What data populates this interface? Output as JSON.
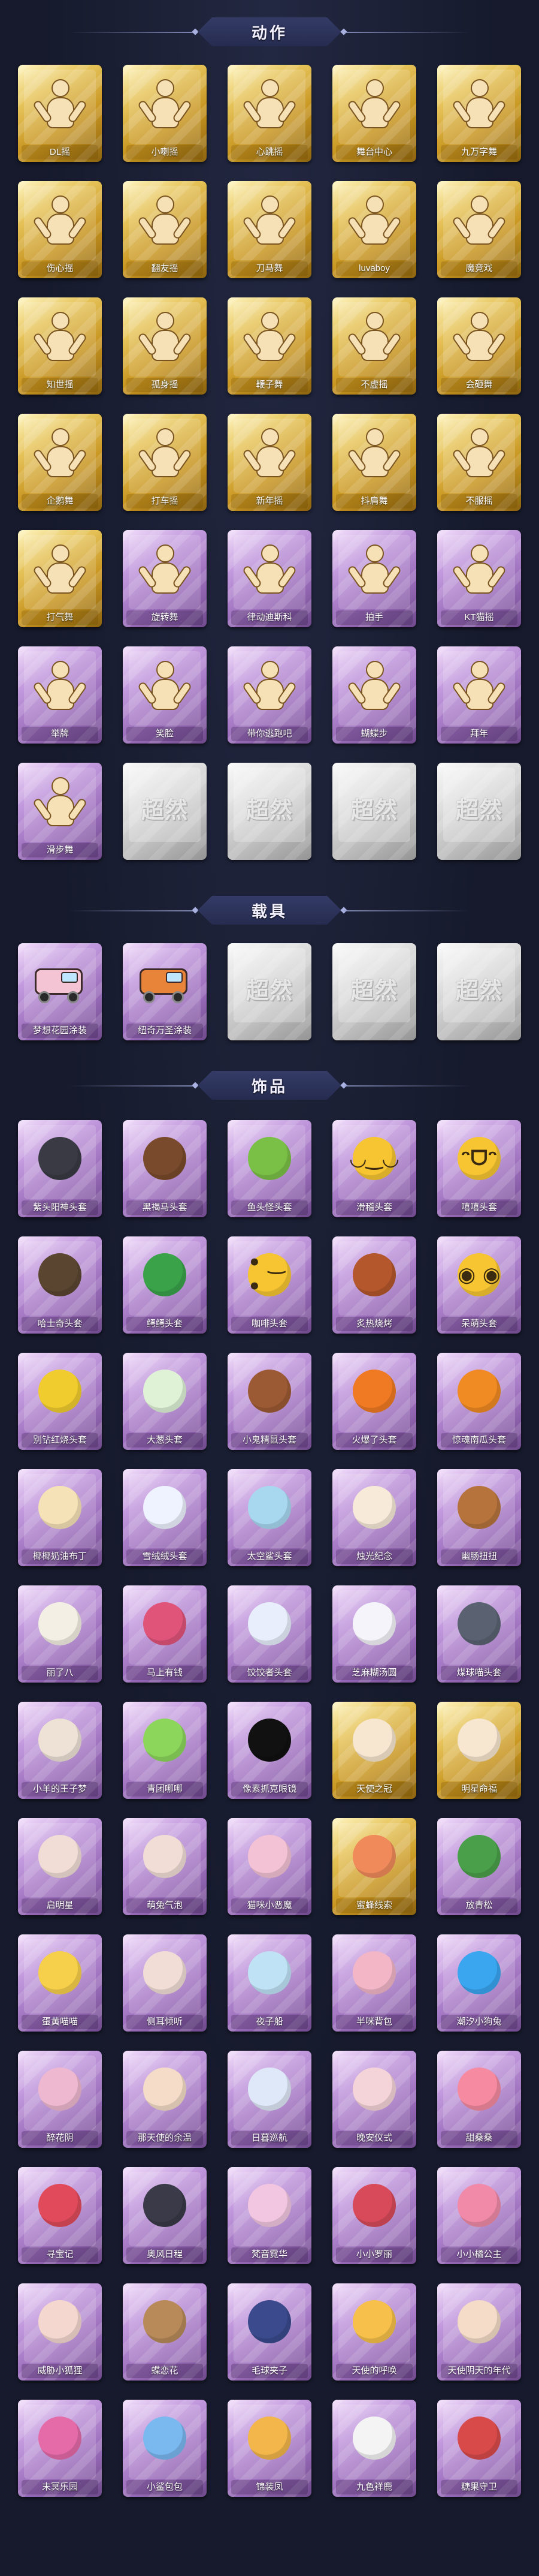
{
  "sections": {
    "actions": {
      "title": "动作",
      "items": [
        {
          "label": "DL摇",
          "tier": "gold"
        },
        {
          "label": "小喇摇",
          "tier": "gold"
        },
        {
          "label": "心跳摇",
          "tier": "gold"
        },
        {
          "label": "舞台中心",
          "tier": "gold"
        },
        {
          "label": "九万字舞",
          "tier": "gold"
        },
        {
          "label": "伤心摇",
          "tier": "gold"
        },
        {
          "label": "翻友摇",
          "tier": "gold"
        },
        {
          "label": "刀马舞",
          "tier": "gold"
        },
        {
          "label": "luvaboy",
          "tier": "gold"
        },
        {
          "label": "魔竞戏",
          "tier": "gold"
        },
        {
          "label": "知世摇",
          "tier": "gold"
        },
        {
          "label": "孤身摇",
          "tier": "gold"
        },
        {
          "label": "鞭子舞",
          "tier": "gold"
        },
        {
          "label": "不虚摇",
          "tier": "gold"
        },
        {
          "label": "会砸舞",
          "tier": "gold"
        },
        {
          "label": "企鹅舞",
          "tier": "gold"
        },
        {
          "label": "打车摇",
          "tier": "gold"
        },
        {
          "label": "新年摇",
          "tier": "gold"
        },
        {
          "label": "抖肩舞",
          "tier": "gold"
        },
        {
          "label": "不服摇",
          "tier": "gold"
        },
        {
          "label": "打气舞",
          "tier": "gold"
        },
        {
          "label": "旋转舞",
          "tier": "purple"
        },
        {
          "label": "律动迪斯科",
          "tier": "purple"
        },
        {
          "label": "拍手",
          "tier": "purple"
        },
        {
          "label": "KT猫摇",
          "tier": "purple"
        },
        {
          "label": "举牌",
          "tier": "purple"
        },
        {
          "label": "笑脸",
          "tier": "purple"
        },
        {
          "label": "带你逃跑吧",
          "tier": "purple"
        },
        {
          "label": "蝴蝶步",
          "tier": "purple"
        },
        {
          "label": "拜年",
          "tier": "purple"
        },
        {
          "label": "滑步舞",
          "tier": "purple"
        },
        {
          "label": "",
          "tier": "silver"
        },
        {
          "label": "",
          "tier": "silver"
        },
        {
          "label": "",
          "tier": "silver"
        },
        {
          "label": "",
          "tier": "silver"
        }
      ]
    },
    "vehicles": {
      "title": "载具",
      "items": [
        {
          "label": "梦想花园涂装",
          "tier": "purple",
          "color": "#f4c3d4"
        },
        {
          "label": "纽奇万圣涂装",
          "tier": "purple",
          "color": "#e7843a"
        },
        {
          "label": "",
          "tier": "silver"
        },
        {
          "label": "",
          "tier": "silver"
        },
        {
          "label": "",
          "tier": "silver"
        }
      ]
    },
    "ornaments": {
      "title": "饰品",
      "items": [
        {
          "label": "紫头阳神头套",
          "tier": "purple",
          "icon": "black-round-icon",
          "color": "#3a3a44"
        },
        {
          "label": "黑褐马头套",
          "tier": "purple",
          "icon": "horse-head-icon",
          "color": "#7a4a2c"
        },
        {
          "label": "鱼头怪头套",
          "tier": "purple",
          "icon": "fish-head-icon",
          "color": "#7ac046"
        },
        {
          "label": "滑稽头套",
          "tier": "purple",
          "icon": "funny-emoji-icon",
          "color": "#f6c531",
          "face": "◡‿◡"
        },
        {
          "label": "嘻嘻头套",
          "tier": "purple",
          "icon": "grin-emoji-icon",
          "color": "#f6c531",
          "face": "ᵔᗜᵔ"
        },
        {
          "label": "哈士奇头套",
          "tier": "purple",
          "icon": "husky-head-icon",
          "color": "#5a4530"
        },
        {
          "label": "鳄鳄头套",
          "tier": "purple",
          "icon": "crocodile-head-icon",
          "color": "#3aa34a"
        },
        {
          "label": "咖啡头套",
          "tier": "purple",
          "icon": "smile-emoji-icon",
          "color": "#f6c531",
          "face": "• ‿ •"
        },
        {
          "label": "炙热烧烤",
          "tier": "purple",
          "icon": "bbq-head-icon",
          "color": "#b4572c"
        },
        {
          "label": "呆萌头套",
          "tier": "purple",
          "icon": "dazed-emoji-icon",
          "color": "#f6c531",
          "face": "◉ ◉"
        },
        {
          "label": "别钻红烧头套",
          "tier": "purple",
          "icon": "pikachu-head-icon",
          "color": "#f1cc2e"
        },
        {
          "label": "大葱头套",
          "tier": "purple",
          "icon": "scallion-head-icon",
          "color": "#dff2d6"
        },
        {
          "label": "小鬼精鼠头套",
          "tier": "purple",
          "icon": "poop-head-icon",
          "color": "#9c5a34"
        },
        {
          "label": "火爆了头套",
          "tier": "purple",
          "icon": "fire-head-icon",
          "color": "#f07a23"
        },
        {
          "label": "惊魂南瓜头套",
          "tier": "purple",
          "icon": "pumpkin-head-icon",
          "color": "#f08a23"
        },
        {
          "label": "椰椰奶油布丁",
          "tier": "purple",
          "icon": "pudding-head-icon",
          "color": "#f5e2b6"
        },
        {
          "label": "雪绒绒头套",
          "tier": "purple",
          "icon": "snow-head-icon",
          "color": "#eef3ff"
        },
        {
          "label": "太空鲨头套",
          "tier": "purple",
          "icon": "shark-head-icon",
          "color": "#a8d8f0"
        },
        {
          "label": "烛光纪念",
          "tier": "purple",
          "icon": "candle-head-icon",
          "color": "#f7ead8"
        },
        {
          "label": "幽肠扭扭",
          "tier": "purple",
          "icon": "sausage-dog-icon",
          "color": "#b6743c"
        },
        {
          "label": "丽了八",
          "tier": "purple",
          "icon": "onion-head-icon",
          "color": "#f4efe4"
        },
        {
          "label": "马上有钱",
          "tier": "purple",
          "icon": "bird-head-icon",
          "color": "#e0547a"
        },
        {
          "label": "饺饺者头套",
          "tier": "purple",
          "icon": "cloud-head-icon",
          "color": "#e8eefc"
        },
        {
          "label": "芝麻糊汤圆",
          "tier": "purple",
          "icon": "dumpling-head-icon",
          "color": "#f4f4fa"
        },
        {
          "label": "煤球喵头套",
          "tier": "purple",
          "icon": "cat-head-icon",
          "color": "#5a6272"
        },
        {
          "label": "小羊的王子梦",
          "tier": "purple",
          "icon": "prince-head-icon",
          "color": "#eee2d6"
        },
        {
          "label": "青团哪哪",
          "tier": "purple",
          "icon": "green-ball-icon",
          "color": "#8cd65c"
        },
        {
          "label": "像素抓克眼镜",
          "tier": "purple",
          "icon": "pixel-glasses-icon",
          "color": "#111111"
        },
        {
          "label": "天使之冠",
          "tier": "gold",
          "icon": "angel-crown-icon",
          "color": "#f7e6d0"
        },
        {
          "label": "明星命福",
          "tier": "gold",
          "icon": "star-head-icon",
          "color": "#f7e6d0"
        },
        {
          "label": "启明星",
          "tier": "purple",
          "icon": "venus-head-icon",
          "color": "#f2ddd6"
        },
        {
          "label": "萌兔气泡",
          "tier": "purple",
          "icon": "bunny-bubble-icon",
          "color": "#f2ddd6"
        },
        {
          "label": "猫咪小恶魔",
          "tier": "purple",
          "icon": "devil-cat-icon",
          "color": "#f3c2d4"
        },
        {
          "label": "蜜蜂线索",
          "tier": "gold",
          "icon": "bee-head-icon",
          "color": "#f08a5a"
        },
        {
          "label": "放青松",
          "tier": "purple",
          "icon": "pine-head-icon",
          "color": "#4aa04a"
        },
        {
          "label": "蛋黄喵喵",
          "tier": "purple",
          "icon": "yolk-chick-icon",
          "color": "#f6d04a"
        },
        {
          "label": "侧耳倾听",
          "tier": "purple",
          "icon": "elf-ear-icon",
          "color": "#f2ddd6"
        },
        {
          "label": "夜子船",
          "tier": "purple",
          "icon": "ice-crown-icon",
          "color": "#bfe2f5"
        },
        {
          "label": "半咪背包",
          "tier": "purple",
          "icon": "cake-hat-icon",
          "color": "#f2b6c6"
        },
        {
          "label": "潮汐小狗兔",
          "tier": "purple",
          "icon": "blue-cat-icon",
          "color": "#3aa6f0"
        },
        {
          "label": "醉花阴",
          "tier": "purple",
          "icon": "flower-crown-icon",
          "color": "#eeb8d0"
        },
        {
          "label": "那天使的余温",
          "tier": "purple",
          "icon": "doll-head-icon",
          "color": "#f4dcc8"
        },
        {
          "label": "日暮巡航",
          "tier": "purple",
          "icon": "ghost-head-icon",
          "color": "#dfe8f8"
        },
        {
          "label": "晚安仪式",
          "tier": "purple",
          "icon": "nightcap-icon",
          "color": "#f4d4d8"
        },
        {
          "label": "甜桑桑",
          "tier": "purple",
          "icon": "pig-head-icon",
          "color": "#f58aa0"
        },
        {
          "label": "寻宝记",
          "tier": "purple",
          "icon": "explorer-icon",
          "color": "#e04a5a"
        },
        {
          "label": "奥风日程",
          "tier": "purple",
          "icon": "chef-hat-icon",
          "color": "#3a3a48"
        },
        {
          "label": "梵音霓华",
          "tier": "purple",
          "icon": "lotus-head-icon",
          "color": "#f2c6e0"
        },
        {
          "label": "小小罗丽",
          "tier": "purple",
          "icon": "lolita-icon",
          "color": "#d84a5a"
        },
        {
          "label": "小小橘公主",
          "tier": "purple",
          "icon": "princess-icon",
          "color": "#f08aa8"
        },
        {
          "label": "威胁小狐狸",
          "tier": "purple",
          "icon": "fox-head-icon",
          "color": "#f4d8d0"
        },
        {
          "label": "蝶恋花",
          "tier": "purple",
          "icon": "butterfly-icon",
          "color": "#b88a5a"
        },
        {
          "label": "毛球夹子",
          "tier": "purple",
          "icon": "pompom-clip-icon",
          "color": "#3a4a8c"
        },
        {
          "label": "天使的呼唤",
          "tier": "purple",
          "icon": "angel-wing-icon",
          "color": "#f6c04a"
        },
        {
          "label": "天使阴天的年代",
          "tier": "purple",
          "icon": "fairy-icon",
          "color": "#f4dcc8"
        },
        {
          "label": "末冥乐园",
          "tier": "purple",
          "icon": "clown-icon",
          "color": "#e46aa8"
        },
        {
          "label": "小鲨包包",
          "tier": "purple",
          "icon": "shark-bag-icon",
          "color": "#7ab8f0"
        },
        {
          "label": "锦装凤",
          "tier": "purple",
          "icon": "phoenix-icon",
          "color": "#f2b64a"
        },
        {
          "label": "九色祥鹿",
          "tier": "purple",
          "icon": "deer-icon",
          "color": "#f4f4f4"
        },
        {
          "label": "糖果守卫",
          "tier": "purple",
          "icon": "candy-guard-icon",
          "color": "#d84a4a"
        }
      ]
    }
  },
  "silver_logo_text": "超然"
}
